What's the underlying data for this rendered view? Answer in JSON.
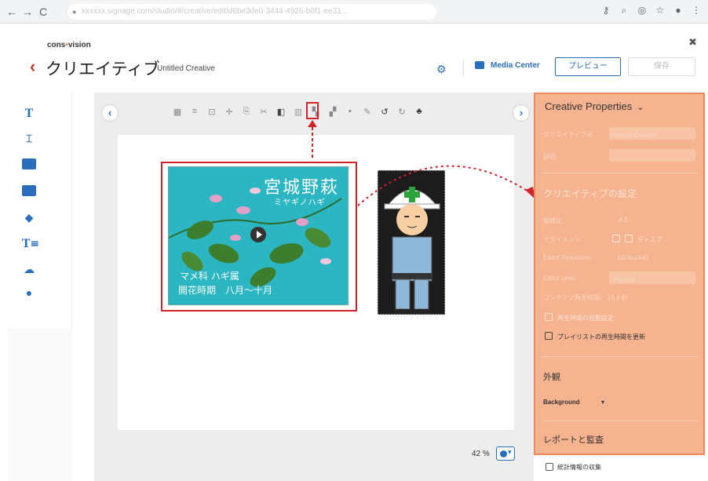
{
  "browser": {
    "url": "xxxxxx.signage.com/studio/#/creative/edit/d6be3de0-3444-4926-b0f1-ee31..."
  },
  "header": {
    "brand_prefix": "cons",
    "brand_suffix": "vision",
    "title": "クリエイティブ",
    "subtitle": "Untitled Creative",
    "media_center": "Media Center",
    "preview": "プレビュー",
    "save": "保存"
  },
  "canvas": {
    "image_title": "宮城野萩",
    "image_sub": "ミヤギノハギ",
    "image_line1": "マメ科 ハギ属",
    "image_line2": "開花時期　八月〜十月",
    "zoom": "42 %"
  },
  "properties": {
    "title": "Creative Properties",
    "name_label": "クリエイティブ名:",
    "name_value": "Untitled Creative",
    "description_label": "説明:",
    "settings_title": "クリエイティブの設定",
    "aspect_label": "縦横比:",
    "aspect_value": "4:3",
    "alignment_label": "アライメント:",
    "alignment_value": "ディスプ...",
    "resolution_label": "Editor Resolution:",
    "resolution_value": "1920x1440",
    "units_label": "Editor Units:",
    "units_value": "Percent",
    "playtime_label": "コンテンツ再生時間:",
    "playtime_value": "15.6 秒",
    "auto_label": "再生時間の自動設定:",
    "playlist_label": "プレイリストの再生時間を更新",
    "appearance_title": "外観",
    "background_label": "Background",
    "report_title": "レポートと監査",
    "stats_label": "統計情報の収集"
  },
  "colors": {
    "accent": "#2a6ebb",
    "highlight": "#d0242b",
    "panel_overlay": "#f6b38f"
  }
}
